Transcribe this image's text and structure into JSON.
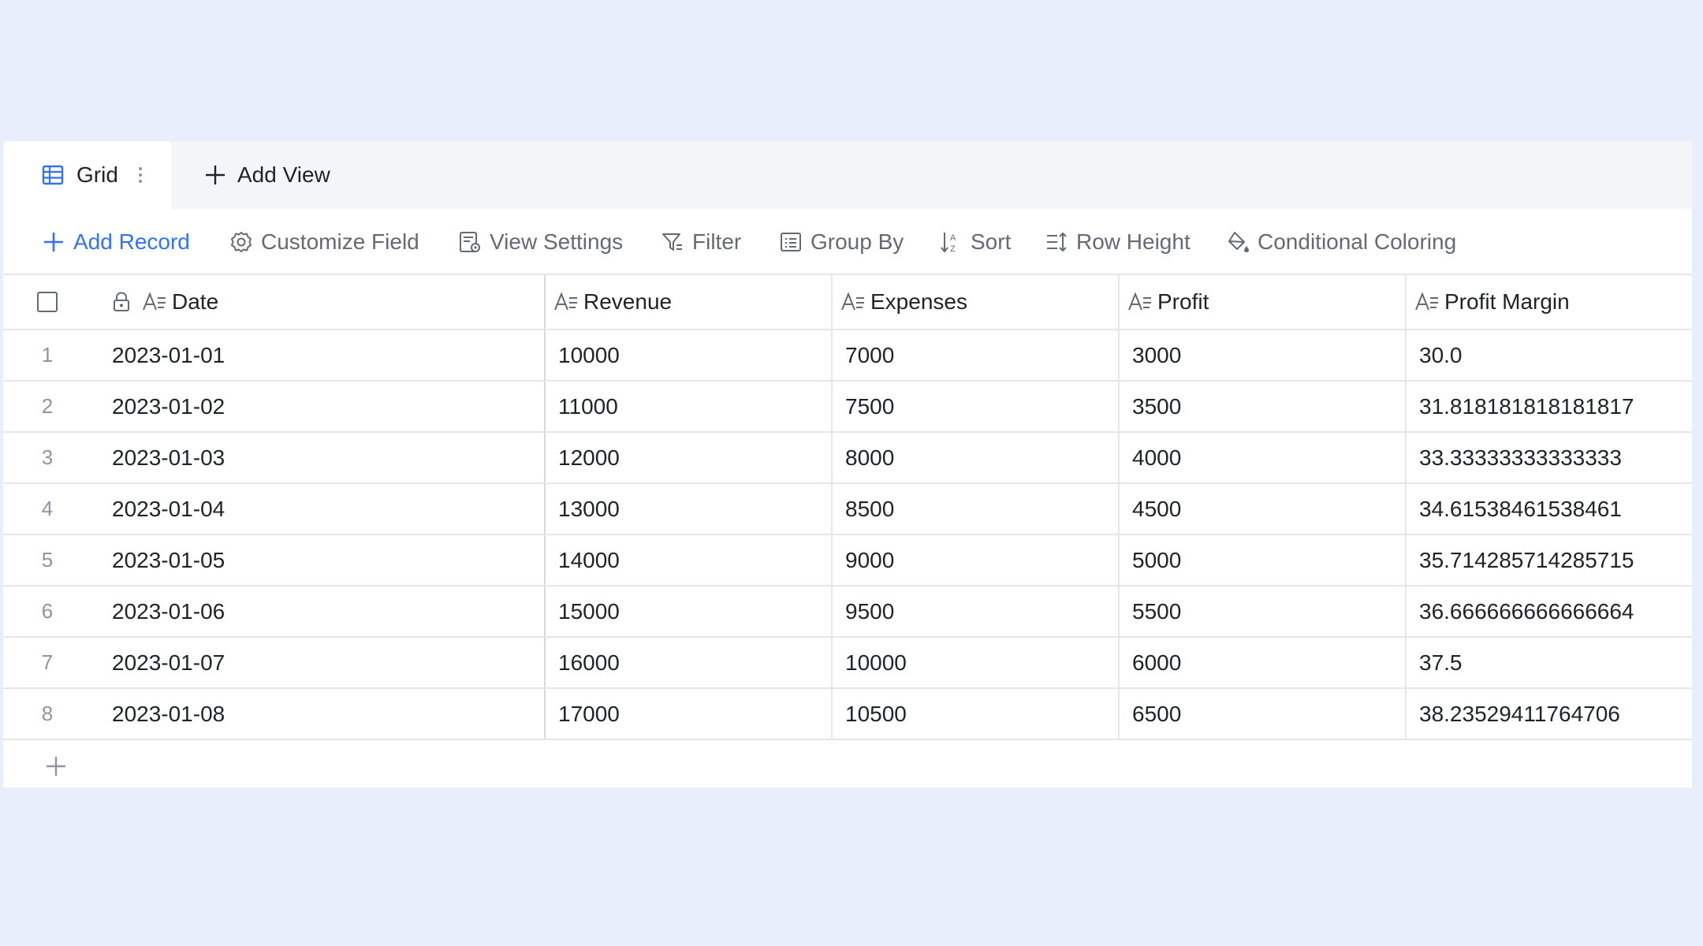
{
  "tabs": {
    "active_label": "Grid",
    "add_view_label": "Add View"
  },
  "toolbar": {
    "add_record": "Add Record",
    "customize_field": "Customize Field",
    "view_settings": "View Settings",
    "filter": "Filter",
    "group_by": "Group By",
    "sort": "Sort",
    "row_height": "Row Height",
    "conditional_coloring": "Conditional Coloring"
  },
  "colors": {
    "accent": "#3370ff",
    "background": "#e8eefc",
    "muted_text": "#646a73"
  },
  "table": {
    "columns": [
      "Date",
      "Revenue",
      "Expenses",
      "Profit",
      "Profit Margin"
    ],
    "rows": [
      {
        "num": "1",
        "date": "2023-01-01",
        "revenue": "10000",
        "expenses": "7000",
        "profit": "3000",
        "margin": "30.0"
      },
      {
        "num": "2",
        "date": "2023-01-02",
        "revenue": "11000",
        "expenses": "7500",
        "profit": "3500",
        "margin": "31.818181818181817"
      },
      {
        "num": "3",
        "date": "2023-01-03",
        "revenue": "12000",
        "expenses": "8000",
        "profit": "4000",
        "margin": "33.33333333333333"
      },
      {
        "num": "4",
        "date": "2023-01-04",
        "revenue": "13000",
        "expenses": "8500",
        "profit": "4500",
        "margin": "34.61538461538461"
      },
      {
        "num": "5",
        "date": "2023-01-05",
        "revenue": "14000",
        "expenses": "9000",
        "profit": "5000",
        "margin": "35.714285714285715"
      },
      {
        "num": "6",
        "date": "2023-01-06",
        "revenue": "15000",
        "expenses": "9500",
        "profit": "5500",
        "margin": "36.666666666666664"
      },
      {
        "num": "7",
        "date": "2023-01-07",
        "revenue": "16000",
        "expenses": "10000",
        "profit": "6000",
        "margin": "37.5"
      },
      {
        "num": "8",
        "date": "2023-01-08",
        "revenue": "17000",
        "expenses": "10500",
        "profit": "6500",
        "margin": "38.23529411764706"
      }
    ]
  }
}
